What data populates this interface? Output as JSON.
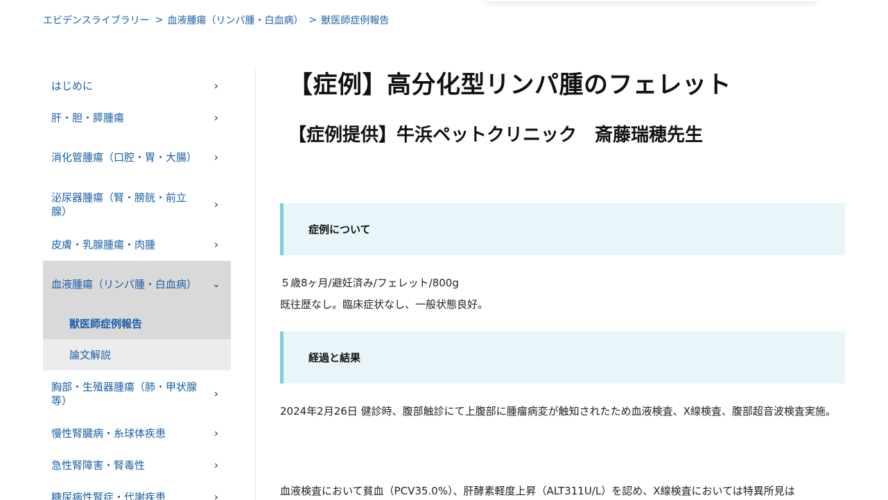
{
  "breadcrumb": {
    "items": [
      "エビデンスライブラリー",
      "血液腫瘍（リンパ腫・白血病）",
      "獣医師症例報告"
    ],
    "separator": ">"
  },
  "sidebar": {
    "items": [
      {
        "label": "はじめに",
        "chevron": "›"
      },
      {
        "label": "肝・胆・膵腫瘍",
        "chevron": "›"
      },
      {
        "label": "消化管腫瘍（口腔・胃・大腸）",
        "chevron": "›"
      },
      {
        "label": "泌尿器腫瘍（腎・膀胱・前立腺）",
        "chevron": "›"
      },
      {
        "label": "皮膚・乳腺腫瘍・肉腫",
        "chevron": "›"
      },
      {
        "label": "血液腫瘍（リンパ腫・白血病）",
        "chevron": "⌄"
      },
      {
        "label": "胸部・生殖器腫瘍（肺・甲状腺等）",
        "chevron": "›"
      },
      {
        "label": "慢性腎臓病・糸球体疾患",
        "chevron": "›"
      },
      {
        "label": "急性腎障害・腎毒性",
        "chevron": "›"
      },
      {
        "label": "糖尿病性腎症・代謝疾患",
        "chevron": "›"
      }
    ],
    "sub_items": [
      {
        "label": "獣医師症例報告"
      },
      {
        "label": "論文解説"
      }
    ]
  },
  "main": {
    "title": "【症例】高分化型リンパ腫のフェレット",
    "subtitle": "【症例提供】牛浜ペットクリニック　斎藤瑞穂先生",
    "sections": [
      {
        "heading": "症例について",
        "paragraphs": [
          "５歳8ヶ月/避妊済み/フェレット/800g",
          "既往歴なし。臨床症状なし、一般状態良好。"
        ]
      },
      {
        "heading": "経過と結果",
        "paragraphs": [
          "2024年2月26日 健診時、腹部触診にて上腹部に腫瘤病変が触知されたため血液検査、X線検査、腹部超音波検査実施。",
          "血液検査において貧血（PCV35.0%）、肝酵素軽度上昇（ALT311U/L）を認め、X線検査においては特異所見は"
        ]
      }
    ]
  },
  "colors": {
    "link": "#1a5fa8",
    "section_bg": "#e8f6fa",
    "section_border": "#7fcddc",
    "active_bg": "#d9d9d9"
  }
}
